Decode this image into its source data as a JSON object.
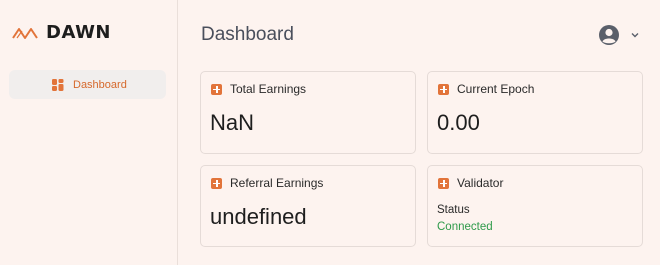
{
  "brand": {
    "name": "DAWN",
    "accent": "#e2743a"
  },
  "sidebar": {
    "items": [
      {
        "label": "Dashboard",
        "icon": "dashboard-icon",
        "active": true
      }
    ]
  },
  "header": {
    "title": "Dashboard",
    "user_icon": "user-avatar-icon",
    "menu_icon": "chevron-down-icon"
  },
  "cards": {
    "total_earnings": {
      "title": "Total Earnings",
      "value": "NaN"
    },
    "current_epoch": {
      "title": "Current Epoch",
      "value": "0.00"
    },
    "referral_earnings": {
      "title": "Referral Earnings",
      "value": "undefined"
    },
    "validator": {
      "title": "Validator",
      "status_label": "Status",
      "status_value": "Connected",
      "status_color": "#2e9a4a"
    }
  }
}
